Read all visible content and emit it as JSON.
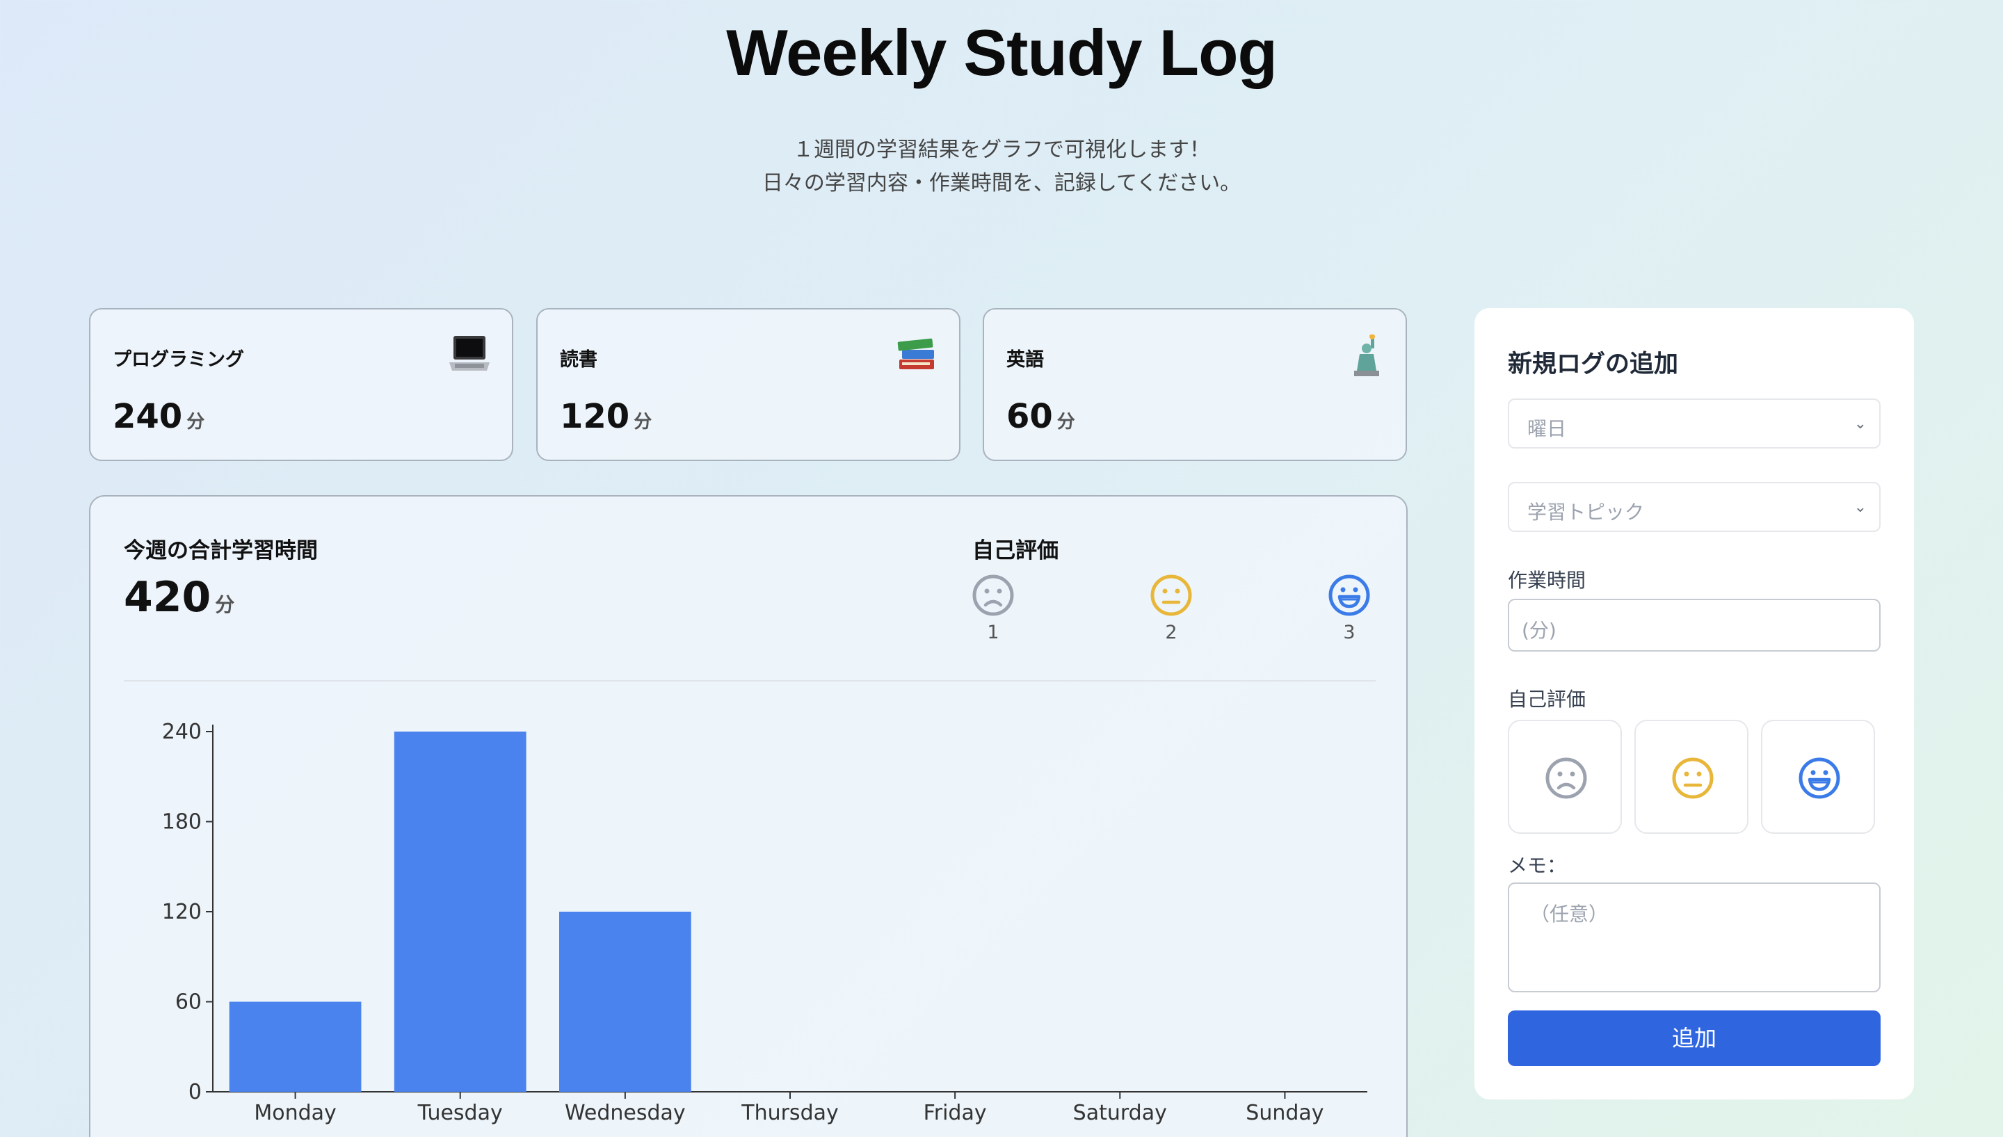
{
  "header": {
    "title": "Weekly Study Log",
    "subtitle_line1": "１週間の学習結果をグラフで可視化します！",
    "subtitle_line2": "日々の学習内容・作業時間を、記録してください。"
  },
  "topic_cards": [
    {
      "name": "プログラミング",
      "icon": "laptop-icon",
      "value": "240",
      "unit": "分"
    },
    {
      "name": "読書",
      "icon": "books-icon",
      "value": "120",
      "unit": "分"
    },
    {
      "name": "英語",
      "icon": "statue-of-liberty-icon",
      "value": "60",
      "unit": "分"
    }
  ],
  "summary": {
    "label": "今週の合計学習時間",
    "value": "420",
    "unit": "分",
    "rating_label": "自己評価",
    "ratings": [
      {
        "icon": "sad-face-icon",
        "number": "1",
        "color": "#9ca3af"
      },
      {
        "icon": "neutral-face-icon",
        "number": "2",
        "color": "#e8b73a"
      },
      {
        "icon": "happy-face-icon",
        "number": "3",
        "color": "#3b7be8"
      }
    ]
  },
  "chart_data": {
    "type": "bar",
    "categories": [
      "Monday",
      "Tuesday",
      "Wednesday",
      "Thursday",
      "Friday",
      "Saturday",
      "Sunday"
    ],
    "values": [
      60,
      240,
      120,
      0,
      0,
      0,
      0
    ],
    "yticks": [
      "0",
      "60",
      "120",
      "180",
      "240"
    ],
    "ylim": [
      0,
      240
    ],
    "bar_color": "#4a82ee"
  },
  "form": {
    "title": "新規ログの追加",
    "day_placeholder": "曜日",
    "topic_placeholder": "学習トピック",
    "time_label": "作業時間",
    "time_placeholder": "(分)",
    "rating_label": "自己評価",
    "memo_label": "メモ：",
    "memo_placeholder": "（任意）",
    "submit_label": "追加"
  },
  "colors": {
    "accent": "#2f66e0",
    "card_border": "#a9b3bd"
  }
}
